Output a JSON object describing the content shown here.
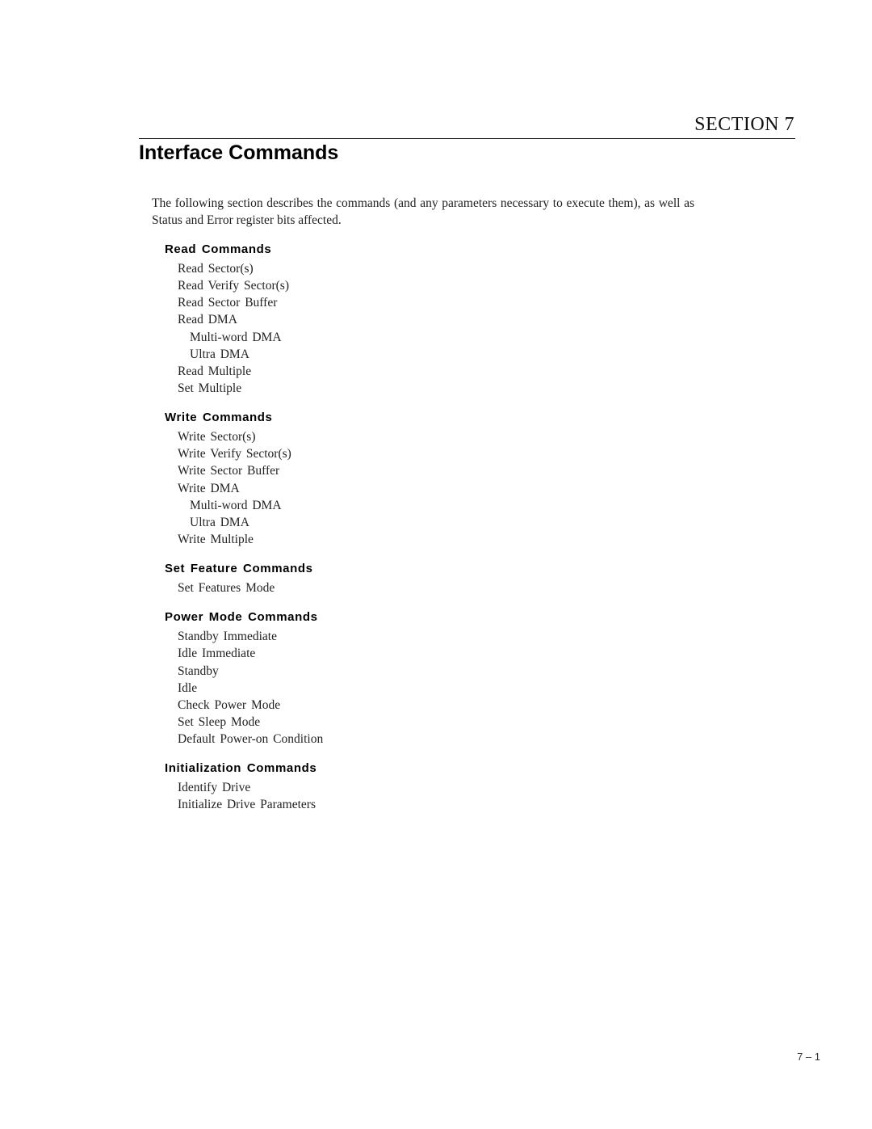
{
  "header": {
    "section_label": "SECTION 7",
    "title": "Interface Commands"
  },
  "intro": "The following section describes the commands (and any parameters necessary to execute them), as well as Status and Error register bits affected.",
  "groups": [
    {
      "heading": "Read Commands",
      "items": [
        {
          "label": "Read Sector(s)",
          "indent": 0
        },
        {
          "label": "Read Verify Sector(s)",
          "indent": 0
        },
        {
          "label": "Read Sector Buffer",
          "indent": 0
        },
        {
          "label": "Read DMA",
          "indent": 0
        },
        {
          "label": "Multi-word DMA",
          "indent": 1
        },
        {
          "label": "Ultra DMA",
          "indent": 1
        },
        {
          "label": "Read Multiple",
          "indent": 0
        },
        {
          "label": "Set Multiple",
          "indent": 0
        }
      ]
    },
    {
      "heading": "Write Commands",
      "items": [
        {
          "label": "Write Sector(s)",
          "indent": 0
        },
        {
          "label": "Write Verify Sector(s)",
          "indent": 0
        },
        {
          "label": "Write Sector Buffer",
          "indent": 0
        },
        {
          "label": "Write DMA",
          "indent": 0
        },
        {
          "label": "Multi-word DMA",
          "indent": 1
        },
        {
          "label": "Ultra DMA",
          "indent": 1
        },
        {
          "label": "Write Multiple",
          "indent": 0
        }
      ]
    },
    {
      "heading": "Set Feature Commands",
      "items": [
        {
          "label": "Set Features Mode",
          "indent": 0
        }
      ]
    },
    {
      "heading": "Power Mode Commands",
      "items": [
        {
          "label": "Standby Immediate",
          "indent": 0
        },
        {
          "label": "Idle Immediate",
          "indent": 0
        },
        {
          "label": "Standby",
          "indent": 0
        },
        {
          "label": "Idle",
          "indent": 0
        },
        {
          "label": "Check Power Mode",
          "indent": 0
        },
        {
          "label": "Set Sleep Mode",
          "indent": 0
        },
        {
          "label": "Default Power-on Condition",
          "indent": 0
        }
      ]
    },
    {
      "heading": "Initialization Commands",
      "items": [
        {
          "label": "Identify Drive",
          "indent": 0
        },
        {
          "label": "Initialize Drive Parameters",
          "indent": 0
        }
      ]
    }
  ],
  "footer": {
    "page_number": "7 – 1"
  }
}
